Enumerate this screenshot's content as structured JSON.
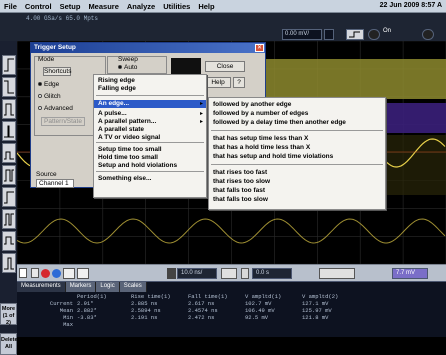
{
  "menubar": {
    "items": [
      "File",
      "Control",
      "Setup",
      "Measure",
      "Analyze",
      "Utilities",
      "Help"
    ],
    "datetime": "22 Jun 2009  8:57 A"
  },
  "toolbar": {
    "acquisition": "4.00 GSa/s   65.0 Mpts",
    "scale_readout": "0.00 mV/",
    "trigger_on": "On"
  },
  "sidebar": {
    "more_label": "More (1 of 2)",
    "delete_label": "Delete All"
  },
  "dialog": {
    "title": "Trigger Setup",
    "mode_label": "Mode",
    "shortcuts_label": "Shortcuts",
    "modes": [
      "Edge",
      "Glitch",
      "Advanced"
    ],
    "selected_mode": "Edge",
    "mode_field": "Pattern/State",
    "sweep_label": "Sweep",
    "sweep_auto": "Auto",
    "source_label": "Source",
    "source_value": "Channel 1",
    "close_button": "Close",
    "help_button": "Help"
  },
  "menu1": {
    "items": [
      "Rising edge",
      "Falling edge",
      "An edge...",
      "A pulse...",
      "A parallel pattern...",
      "A parallel state",
      "A TV or video signal",
      "Setup time too small",
      "Hold time too small",
      "Setup and hold violations",
      "Something else..."
    ],
    "highlighted": "An edge..."
  },
  "menu2": {
    "items": [
      "followed by another edge",
      "followed by a number of edges",
      "followed by a delay time then another edge",
      "that has setup time less than X",
      "that has a hold time less than X",
      "that has setup and hold time violations",
      "that rises too fast",
      "that rises too slow",
      "that falls too fast",
      "that falls too slow"
    ]
  },
  "controlbar": {
    "horizontal_scale": "10.0 ns/",
    "delay": "0.0 s",
    "right_value": "7.7 mV"
  },
  "measurements": {
    "tabs": [
      "Measurements",
      "Markers",
      "Logic",
      "Scales"
    ],
    "columns": [
      "",
      "Period(1)",
      "Rise time(1)",
      "Fall time(1)",
      "V ampltd(1)",
      "V ampltd(2)"
    ],
    "rows": [
      [
        "Current",
        "2.91*",
        "2.885 ns",
        "2.617 ns",
        "102.7 mV",
        "127.1 mV"
      ],
      [
        "Mean",
        "2.882*",
        "2.5894 ns",
        "2.4574 ns",
        "106.49 mV",
        "125.97 mV"
      ],
      [
        "Min",
        "-3.83*",
        "2.191 ns",
        "2.472 ns",
        "92.5 mV",
        "121.8 mV"
      ],
      [
        "Max",
        "",
        "",
        "",
        "",
        ""
      ]
    ]
  },
  "colors": {
    "channel1": "#e7d04a",
    "channel2": "#3fbf4a",
    "channel3": "#7a5cd6",
    "highlight": "#2c5ac8"
  }
}
